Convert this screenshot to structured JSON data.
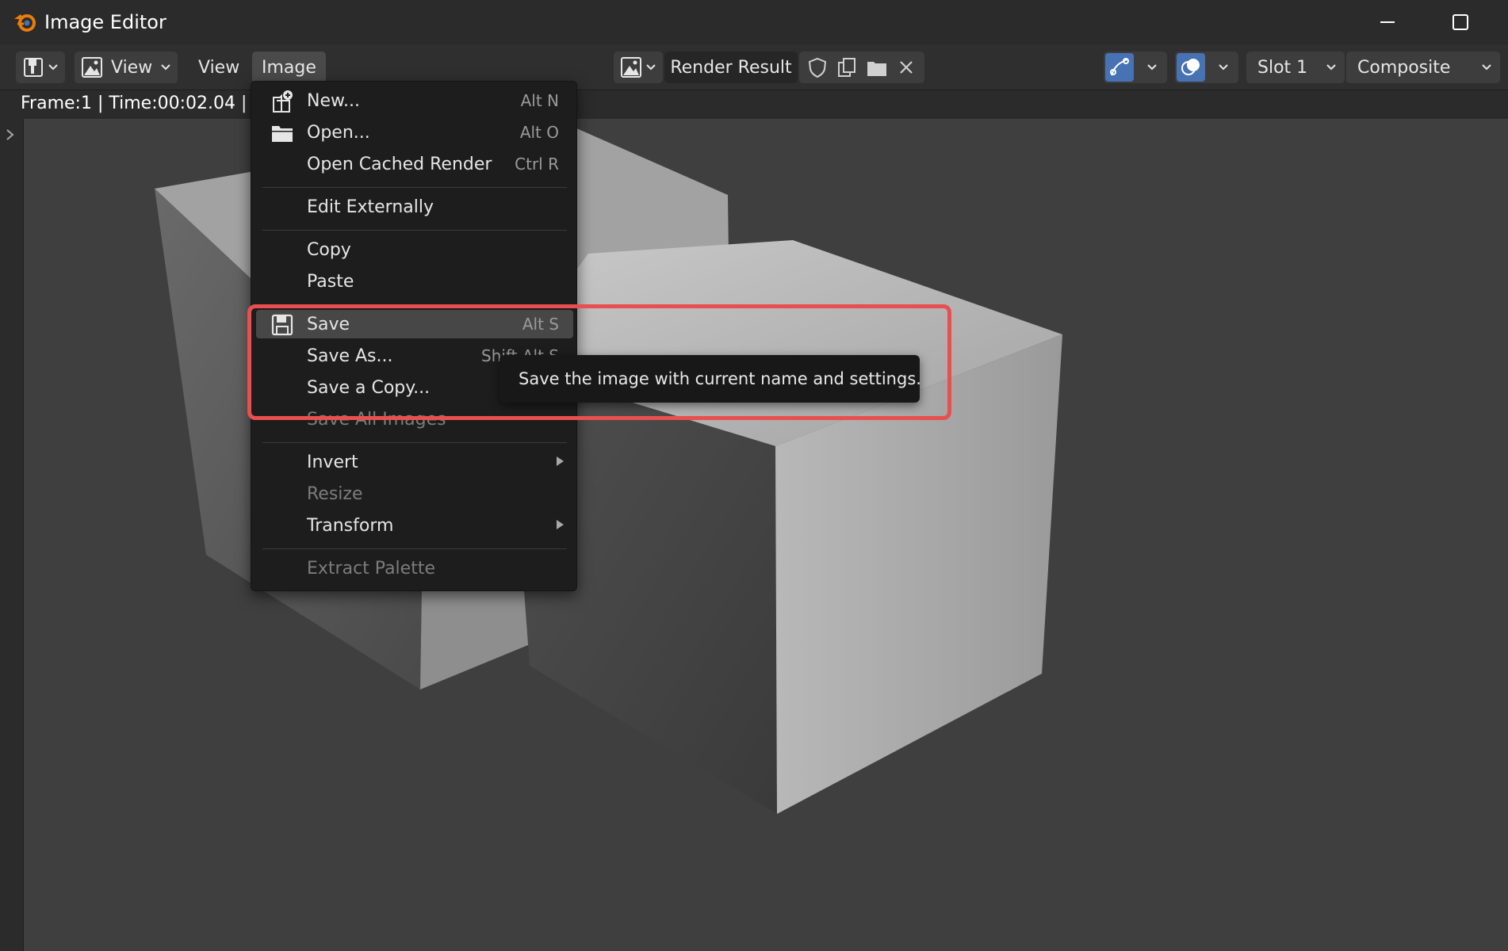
{
  "window": {
    "title": "Image Editor"
  },
  "header": {
    "editor_type_icon": "image-editor-icon",
    "view_dropdown_label": "View",
    "menus": [
      "View",
      "Image"
    ],
    "image_datablock": "Render Result",
    "slot": "Slot 1",
    "layer": "Composite"
  },
  "frame_info": "Frame:1 | Time:00:02.04 | M",
  "image_menu": {
    "items": [
      {
        "label": "New...",
        "shortcut": "Alt N",
        "icon": "new-image-icon"
      },
      {
        "label": "Open...",
        "shortcut": "Alt O",
        "icon": "folder-icon"
      },
      {
        "label": "Open Cached Render",
        "shortcut": "Ctrl R"
      },
      {
        "label": "Edit Externally"
      },
      {
        "label": "Copy"
      },
      {
        "label": "Paste"
      },
      {
        "label": "Save",
        "shortcut": "Alt S",
        "icon": "save-icon"
      },
      {
        "label": "Save As...",
        "shortcut": "Shift Alt S"
      },
      {
        "label": "Save a Copy..."
      },
      {
        "label": "Save All Images"
      },
      {
        "label": "Invert"
      },
      {
        "label": "Resize"
      },
      {
        "label": "Transform"
      },
      {
        "label": "Extract Palette"
      }
    ]
  },
  "tooltip": "Save the image with current name and settings.",
  "colors": {
    "highlight": "#e94f4f",
    "accent_blue": "#4772b3",
    "logo_orange": "#e87d0d"
  }
}
